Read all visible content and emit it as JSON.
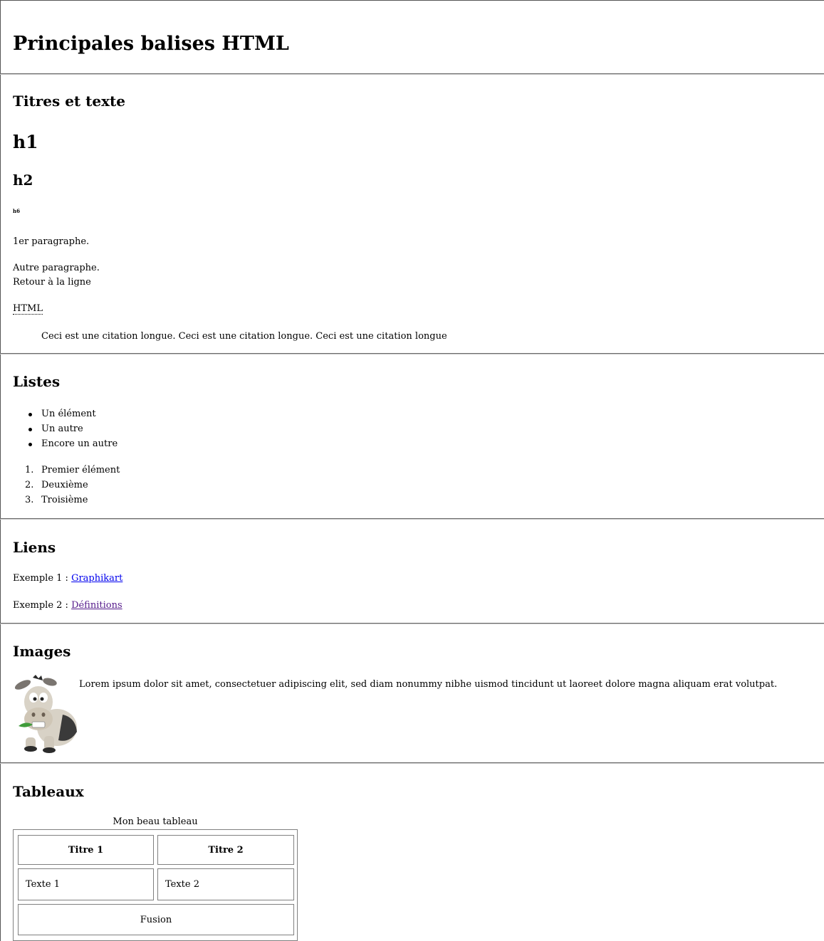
{
  "page": {
    "title": "Principales balises HTML"
  },
  "text_section": {
    "title": "Titres et texte",
    "h1_sample": "h1",
    "h2_sample": "h2",
    "h6_sample": "h6",
    "paragraph1": "1er paragraphe.",
    "paragraph2_line1": "Autre paragraphe.",
    "paragraph2_line2": "Retour à la ligne",
    "abbr": "HTML",
    "blockquote": "Ceci est une citation longue. Ceci est une citation longue. Ceci est une citation longue"
  },
  "lists_section": {
    "title": "Listes",
    "unordered": [
      "Un élément",
      "Un autre",
      "Encore un autre"
    ],
    "ordered": [
      {
        "num": "1.",
        "label": "Premier élément"
      },
      {
        "num": "2.",
        "label": "Deuxième"
      },
      {
        "num": "3.",
        "label": "Troisième"
      }
    ]
  },
  "links_section": {
    "title": "Liens",
    "example1_prefix": "Exemple 1 : ",
    "example1_link": "Graphikart",
    "example2_prefix": "Exemple 2 : ",
    "example2_link": "Définitions"
  },
  "images_section": {
    "title": "Images",
    "image_icon": "donkey-cartoon-icon",
    "caption": "Lorem ipsum dolor sit amet, consectetuer adipiscing elit, sed diam nonummy nibhe uismod tincidunt ut laoreet dolore magna aliquam erat volutpat."
  },
  "tables_section": {
    "title": "Tableaux",
    "caption": "Mon beau tableau",
    "headers": [
      "Titre 1",
      "Titre 2"
    ],
    "row": [
      "Texte 1",
      "Texte 2"
    ],
    "merged": "Fusion"
  },
  "colors": {
    "link": "#0000ee",
    "visited_link": "#551a8b",
    "rule": "#6a6a6a"
  }
}
